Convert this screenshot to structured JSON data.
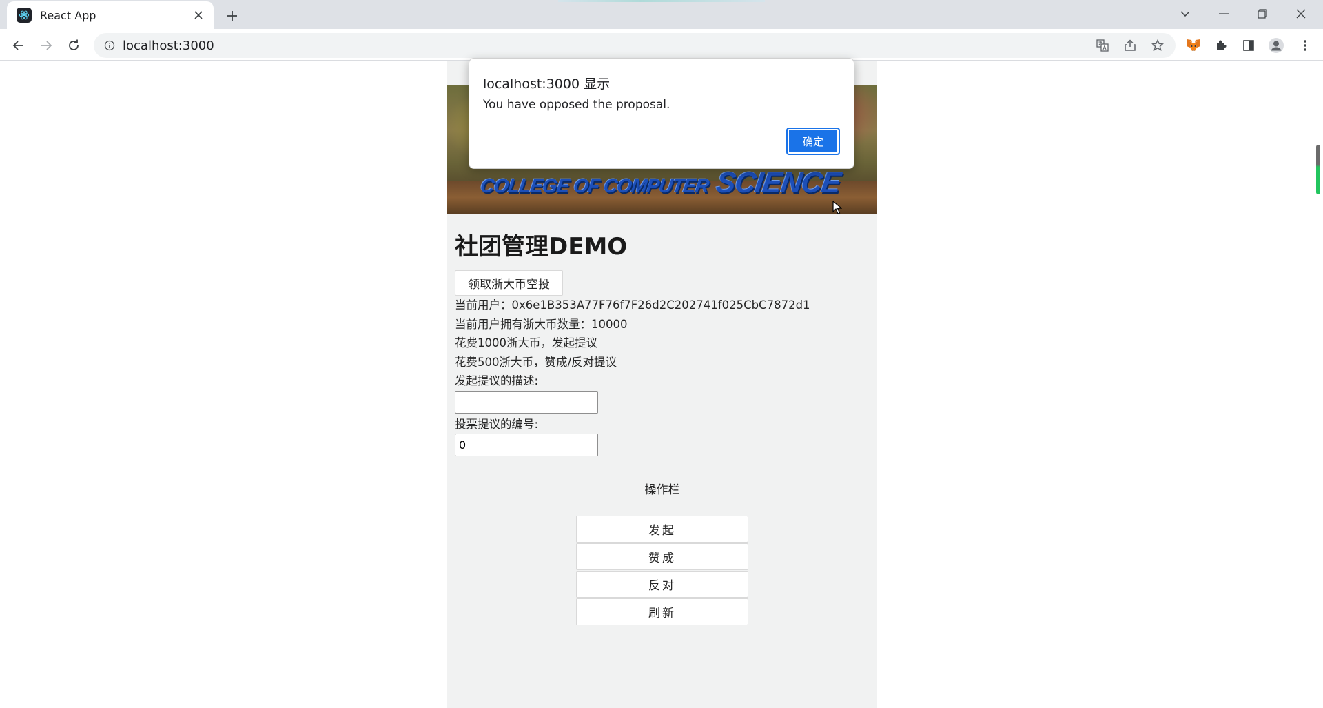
{
  "browser": {
    "tab_title": "React App",
    "url": "localhost:3000"
  },
  "page": {
    "banner_text_small": "COLLEGE OF COMPUTER",
    "banner_text_large": "SCIENCE",
    "title": "社团管理DEMO",
    "airdrop_button": "领取浙大币空投",
    "current_user_line": "当前用户：0x6e1B353A77F76f7F26d2C202741f025CbC7872d1",
    "balance_line": "当前用户拥有浙大币数量：10000",
    "propose_cost_line": "花费1000浙大币，发起提议",
    "vote_cost_line": "花费500浙大币，赞成/反对提议",
    "description_label": "发起提议的描述:",
    "description_value": "",
    "vote_id_label": "投票提议的编号:",
    "vote_id_value": "0",
    "ops_title": "操作栏",
    "buttons": {
      "propose": "发起",
      "approve": "赞成",
      "oppose": "反对",
      "refresh": "刷新"
    }
  },
  "dialog": {
    "title": "localhost:3000 显示",
    "message": "You have opposed the proposal.",
    "ok_label": "确定"
  },
  "colors": {
    "dialog_button": "#1a73e8",
    "app_background": "#f1f2f2",
    "banner_text": "#1d4fb8"
  }
}
